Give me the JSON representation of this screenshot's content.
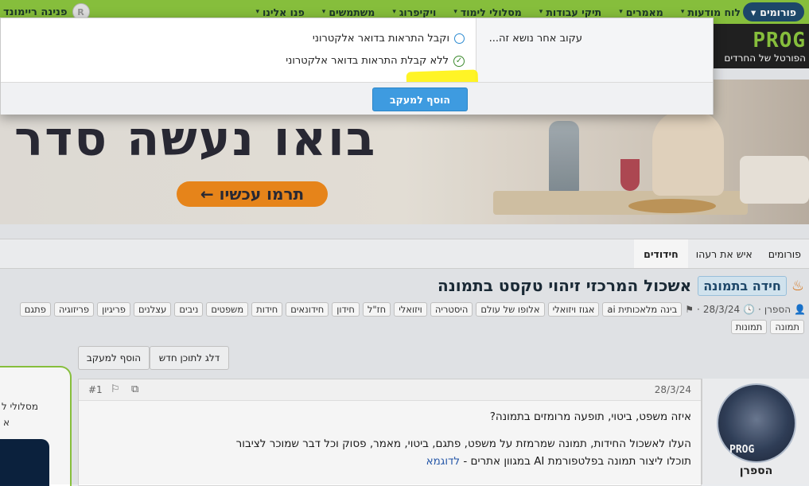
{
  "topnav": {
    "forums_label": "פורומים",
    "items": [
      {
        "label": "לוח מודעות"
      },
      {
        "label": "מאמרים"
      },
      {
        "label": "תיקי עבודות"
      },
      {
        "label": "מסלולי לימוד"
      },
      {
        "label": "ויקיפרוג"
      },
      {
        "label": "משתמשים"
      },
      {
        "label": "פנו אלינו"
      }
    ],
    "user_name": "פנינה ריימונד"
  },
  "logo": {
    "text": "PROG",
    "tagline": "הפורטל של החרדים"
  },
  "banner": {
    "headline": "בואו נעשה סדר",
    "cta": "תרמו עכשיו ←"
  },
  "breadcrumbs": [
    {
      "label": "פורומים"
    },
    {
      "label": "איש את רעהו"
    },
    {
      "label": "חידודים"
    }
  ],
  "thread": {
    "prefix": "חידה בתמונה",
    "title": "אשכול המרכזי זיהוי טקסט בתמונה",
    "author": "הספרן",
    "date": "28/3/24",
    "tags_row1": [
      "בינה מלאכותית ai",
      "אגוז ויזואלי",
      "אלופו של עולם",
      "היסטריה",
      "ויזואלי",
      "חז\"ל",
      "חידון",
      "חידונאים",
      "חידות",
      "משפטים",
      "ניבים",
      "עצלנים",
      "פריגיון",
      "פריזוגיה",
      "פתגם"
    ],
    "tags_row2": [
      "תמונה",
      "תמונות"
    ],
    "skip_button": "דלג לתוכן חדש",
    "watch_button": "הוסף למעקב"
  },
  "post": {
    "date": "28/3/24",
    "number": "#1",
    "line1": "איזה משפט, ביטוי, תופעה מרומזים בתמונה?",
    "line2": "העלו לאשכול החידות, תמונה שמרמזת על משפט, פתגם, ביטוי, מאמר, פסוק וכל דבר שמוכר לציבור",
    "line3": "תוכלו ליצור תמונה בפלטפורמת AI במגוון אתרים - ",
    "link": "לדוגמא",
    "author_name": "הספרן",
    "avatar_text": "PROG"
  },
  "side_panel": {
    "line1": "מסלולי ל",
    "line2": "א"
  },
  "popup": {
    "label": "עקוב אחר נושא זה...",
    "option1": "וקבל התראות בדואר אלקטרוני",
    "option2": "ללא קבלת התראות בדואר אלקטרוני",
    "submit": "הוסף למעקב"
  }
}
